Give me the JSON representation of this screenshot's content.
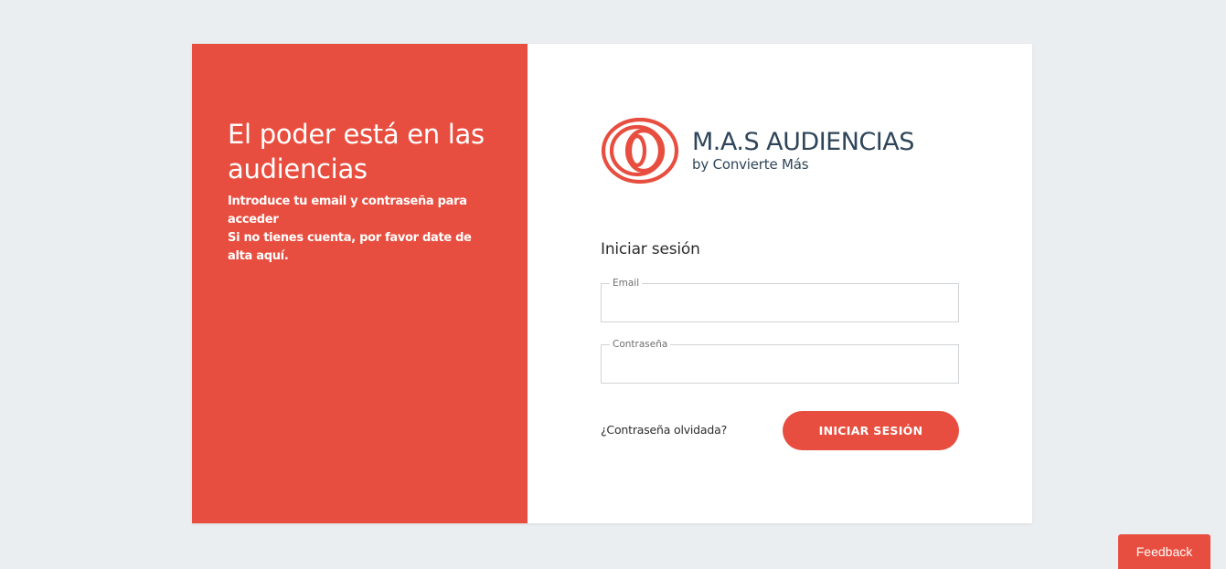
{
  "promo": {
    "headline": "El poder está en las audiencias",
    "line1": "Introduce tu email y contraseña para acceder",
    "line2": "Si no tienes cuenta, por favor date de alta aquí."
  },
  "logo": {
    "icon": "concentric-rings-logo-icon",
    "title": "M.A.S AUDIENCIAS",
    "subtitle": "by Convierte Más"
  },
  "form": {
    "title": "Iniciar sesión",
    "email_label": "Email",
    "email_value": "",
    "password_label": "Contraseña",
    "password_value": "",
    "forgot_label": "¿Contraseña olvidada?",
    "submit_label": "INICIAR SESIÓN"
  },
  "feedback_label": "Feedback",
  "colors": {
    "accent": "#e84e3f",
    "background": "#ebeef0",
    "logo_text": "#2f4559"
  }
}
